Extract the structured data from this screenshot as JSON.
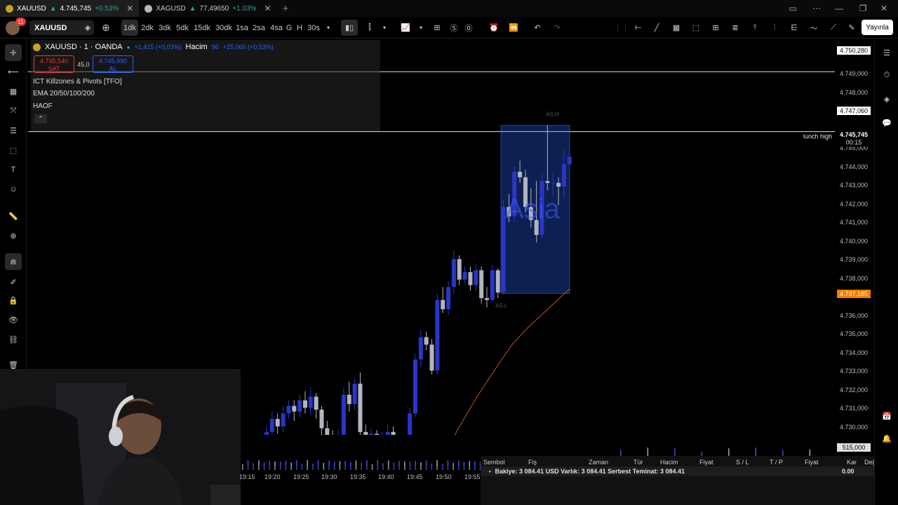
{
  "tabs": [
    {
      "symbol": "XAUUSD",
      "price": "4.745,745",
      "change": "+0.53%",
      "active": true
    },
    {
      "symbol": "XAGUSD",
      "price": "77,49650",
      "change": "+1.03%",
      "active": false
    }
  ],
  "toolbar": {
    "notification_count": "11",
    "symbol": "XAUUSD",
    "intervals": [
      "1dk",
      "2dk",
      "3dk",
      "5dk",
      "15dk",
      "30dk",
      "1sa",
      "2sa",
      "4sa",
      "G",
      "H",
      "30s"
    ],
    "active_interval": "1dk",
    "publish_label": "Yayınla"
  },
  "legend": {
    "title": "XAUUSD · 1 · OANDA",
    "change": "+1,415 (+0,03%)",
    "volume_label": "Hacim",
    "volume_value": "96",
    "volume_change": "+25,060 (+0,53%)",
    "sell_price": "4.745,540",
    "sell_label": "SAT",
    "spread": "45,0",
    "buy_price": "4.745,990",
    "buy_label": "AL",
    "indicators": [
      "ICT Killzones & Pivots [TFO]",
      "EMA 20/50/100/200",
      "HAOF"
    ],
    "collapse_icon": "chevron-up"
  },
  "price_axis": {
    "labels": [
      "4.749,000",
      "4.748,000",
      "4.745,000",
      "4.744,000",
      "4.743,000",
      "4.742,000",
      "4.741,000",
      "4.740,000",
      "4.739,000",
      "4.738,000",
      "4.736,000",
      "4.735,000",
      "4.734,000",
      "4.733,000",
      "4.732,000",
      "4.731,000",
      "4.730,000"
    ],
    "top_line_price": "4.750,280",
    "lunch_high_price": "4.747,060",
    "current_price": "4.745,745",
    "countdown": "00:15",
    "ema_price": "4.737,185",
    "volume_value": "515,000",
    "lunch_high_label": "lunch high"
  },
  "chart_data": {
    "type": "candlestick",
    "ylim": [
      4729.5,
      4751.0
    ],
    "x": [
      "19:15",
      "19:20",
      "19:25",
      "19:30",
      "19:35",
      "19:40",
      "19:45",
      "19:50",
      "19:55"
    ],
    "annotations": {
      "asia_box_label": "Asia",
      "asia_high_label": "AS.H",
      "asia_low_label": "AS.L"
    },
    "colors": {
      "bull": "#2936c7",
      "bear": "#b2b5be",
      "ema": "#b8551e",
      "box": "#2962ff",
      "tag_orange": "#f57c00"
    }
  },
  "time_axis": [
    "19:15",
    "19:20",
    "19:25",
    "19:30",
    "19:35",
    "19:40",
    "19:45",
    "19:50",
    "19:55"
  ],
  "trading_panel": {
    "columns": [
      "Sembol",
      "Fiş",
      "Zaman",
      "Tür",
      "Hacim",
      "Fiyat",
      "S / L",
      "T / P",
      "Fiyat",
      "Kar",
      "Değişim"
    ],
    "balance_line": "Bakiye: 3 084.41 USD  Varlık: 3 084.41  Serbest Teminat: 3 084.41",
    "profit_value": "0.00"
  }
}
